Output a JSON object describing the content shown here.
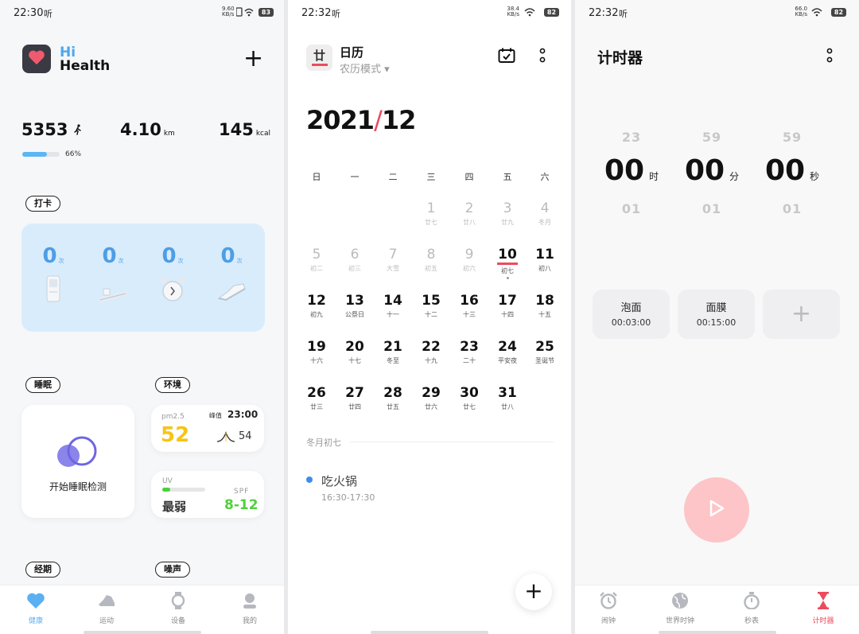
{
  "panels": {
    "health": {
      "status": {
        "time": "22:30",
        "carrier_icon": "听",
        "net_speed": "9.60 KB/s",
        "battery": "83"
      },
      "brand": {
        "hi": "Hi",
        "name": "Health"
      },
      "add_label": "+",
      "stats": {
        "steps": "5353",
        "distance": "4.10",
        "distance_unit": "km",
        "calories": "145",
        "calories_unit": "kcal",
        "progress_percent": 66,
        "progress_label": "66%"
      },
      "checkin": {
        "tag": "打卡",
        "items": [
          {
            "count": "0",
            "unit": "次",
            "icon": "water-purifier-icon"
          },
          {
            "count": "0",
            "unit": "次",
            "icon": "toothbrush-icon"
          },
          {
            "count": "0",
            "unit": "次",
            "icon": "alarm-clock-icon"
          },
          {
            "count": "0",
            "unit": "次",
            "icon": "sneaker-icon"
          }
        ]
      },
      "sleep": {
        "tag": "睡眠",
        "label": "开始睡眠检测"
      },
      "environment": {
        "tag": "环境",
        "pm_label": "pm2.5",
        "peak_label": "峰值",
        "peak_time": "23:00",
        "pm_value": "52",
        "pm_peak": "54",
        "uv_label": "UV",
        "uv_level": 0.18,
        "uv_value": "最弱",
        "spf_label": "SPF",
        "spf_value": "8-12"
      },
      "period_tag": "经期",
      "noise_tag": "噪声",
      "nav": [
        {
          "label": "健康",
          "icon": "heart-icon",
          "active": true
        },
        {
          "label": "运动",
          "icon": "shoe-icon",
          "active": false
        },
        {
          "label": "设备",
          "icon": "watch-icon",
          "active": false
        },
        {
          "label": "我的",
          "icon": "user-icon",
          "active": false
        }
      ],
      "colors": {
        "accent": "#5bb0f2",
        "pm": "#f5c518",
        "spf": "#4fd13b"
      }
    },
    "calendar": {
      "status": {
        "time": "22:32",
        "carrier_icon": "听",
        "net_speed": "38.4 KB/s",
        "battery": "82"
      },
      "logo_char": "廿",
      "title": "日历",
      "mode": "农历模式 ▾",
      "month_year": "2021",
      "month_sep": "/",
      "month_num": "12",
      "weekdays": [
        "日",
        "一",
        "二",
        "三",
        "四",
        "五",
        "六"
      ],
      "weeks": [
        [
          null,
          null,
          null,
          {
            "d": "1",
            "l": "廿七",
            "muted": true
          },
          {
            "d": "2",
            "l": "廿八",
            "muted": true
          },
          {
            "d": "3",
            "l": "廿九",
            "muted": true
          },
          {
            "d": "4",
            "l": "冬月",
            "muted": true
          }
        ],
        [
          {
            "d": "5",
            "l": "初二",
            "muted": true
          },
          {
            "d": "6",
            "l": "初三",
            "muted": true
          },
          {
            "d": "7",
            "l": "大雪",
            "muted": true
          },
          {
            "d": "8",
            "l": "初五",
            "muted": true
          },
          {
            "d": "9",
            "l": "初六",
            "muted": true
          },
          {
            "d": "10",
            "l": "初七",
            "today": true
          },
          {
            "d": "11",
            "l": "初八"
          }
        ],
        [
          {
            "d": "12",
            "l": "初九"
          },
          {
            "d": "13",
            "l": "公祭日"
          },
          {
            "d": "14",
            "l": "十一"
          },
          {
            "d": "15",
            "l": "十二"
          },
          {
            "d": "16",
            "l": "十三"
          },
          {
            "d": "17",
            "l": "十四"
          },
          {
            "d": "18",
            "l": "十五"
          }
        ],
        [
          {
            "d": "19",
            "l": "十六"
          },
          {
            "d": "20",
            "l": "十七"
          },
          {
            "d": "21",
            "l": "冬至"
          },
          {
            "d": "22",
            "l": "十九"
          },
          {
            "d": "23",
            "l": "二十"
          },
          {
            "d": "24",
            "l": "平安夜"
          },
          {
            "d": "25",
            "l": "圣诞节"
          }
        ],
        [
          {
            "d": "26",
            "l": "廿三"
          },
          {
            "d": "27",
            "l": "廿四"
          },
          {
            "d": "28",
            "l": "廿五"
          },
          {
            "d": "29",
            "l": "廿六"
          },
          {
            "d": "30",
            "l": "廿七"
          },
          {
            "d": "31",
            "l": "廿八"
          },
          null
        ]
      ],
      "selected_lunar": "冬月初七",
      "event": {
        "title": "吃火锅",
        "time": "16:30-17:30",
        "color": "#3d8ee9"
      },
      "fab_label": "+"
    },
    "timer": {
      "status": {
        "time": "22:32",
        "carrier_icon": "听",
        "net_speed": "66.0 KB/s",
        "battery": "82"
      },
      "title": "计时器",
      "wheels": [
        {
          "above": "23",
          "value": "00",
          "unit": "时",
          "below": "01"
        },
        {
          "above": "59",
          "value": "00",
          "unit": "分",
          "below": "01"
        },
        {
          "above": "59",
          "value": "00",
          "unit": "秒",
          "below": "01"
        }
      ],
      "presets": [
        {
          "name": "泡面",
          "time": "00:03:00"
        },
        {
          "name": "面膜",
          "time": "00:15:00"
        }
      ],
      "add_preset_label": "+",
      "nav": [
        {
          "label": "闹钟",
          "icon": "alarm-icon",
          "active": false
        },
        {
          "label": "世界时钟",
          "icon": "globe-icon",
          "active": false
        },
        {
          "label": "秒表",
          "icon": "stopwatch-icon",
          "active": false
        },
        {
          "label": "计时器",
          "icon": "hourglass-icon",
          "active": true
        }
      ],
      "colors": {
        "accent": "#ec4b5f",
        "play": "#fdc5c7"
      }
    }
  }
}
